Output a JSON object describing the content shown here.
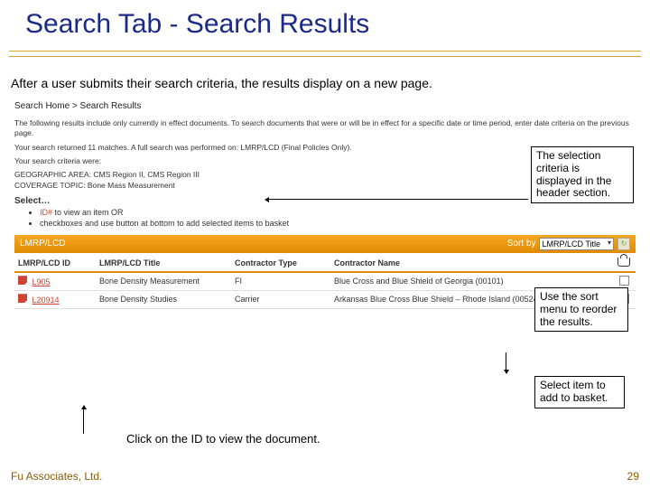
{
  "slide": {
    "title": "Search Tab - Search Results",
    "intro": "After a user submits their search criteria, the results display on a new page.",
    "footer_left": "Fu Associates, Ltd.",
    "footer_right": "29",
    "caption_click": "Click on the ID to view the document."
  },
  "annotations": {
    "header": "The selection criteria is displayed in the header section.",
    "sort": "Use the sort menu to reorder the results.",
    "basket": "Select item to add to basket."
  },
  "panel": {
    "breadcrumb": "Search Home > Search Results",
    "para1": "The following results include only currently in effect documents. To search documents that were or will be in effect for a specific date or time period, enter date criteria on the previous page.",
    "para2_a": "Your search returned 11 matches.   A full search was performed on:   LMRP/LCD (Final Policies Only).",
    "para2_b": "Your search criteria were:",
    "crit1": "GEOGRAPHIC AREA: CMS Region II, CMS Region III",
    "crit2": "COVERAGE TOPIC: Bone Mass Measurement",
    "select_heading": "Select…",
    "bullet1_a": "ID#",
    "bullet1_b": " to view an item OR",
    "bullet2": "checkboxes and use button at bottom to add selected items to basket",
    "section_label": "LMRP/LCD",
    "sort_label": "Sort by",
    "sort_value": "LMRP/LCD Title",
    "columns": {
      "id": "LMRP/LCD ID",
      "title": "LMRP/LCD Title",
      "ctype": "Contractor Type",
      "cname": "Contractor Name"
    },
    "rows": [
      {
        "id": "L905",
        "title": "Bone Density Measurement",
        "ctype": "FI",
        "cname": "Blue Cross and Blue Shield of Georgia (00101)"
      },
      {
        "id": "L20914",
        "title": "Bone Density Studies",
        "ctype": "Carrier",
        "cname": "Arkansas Blue Cross Blue Shield – Rhode Island (00524)"
      }
    ]
  }
}
